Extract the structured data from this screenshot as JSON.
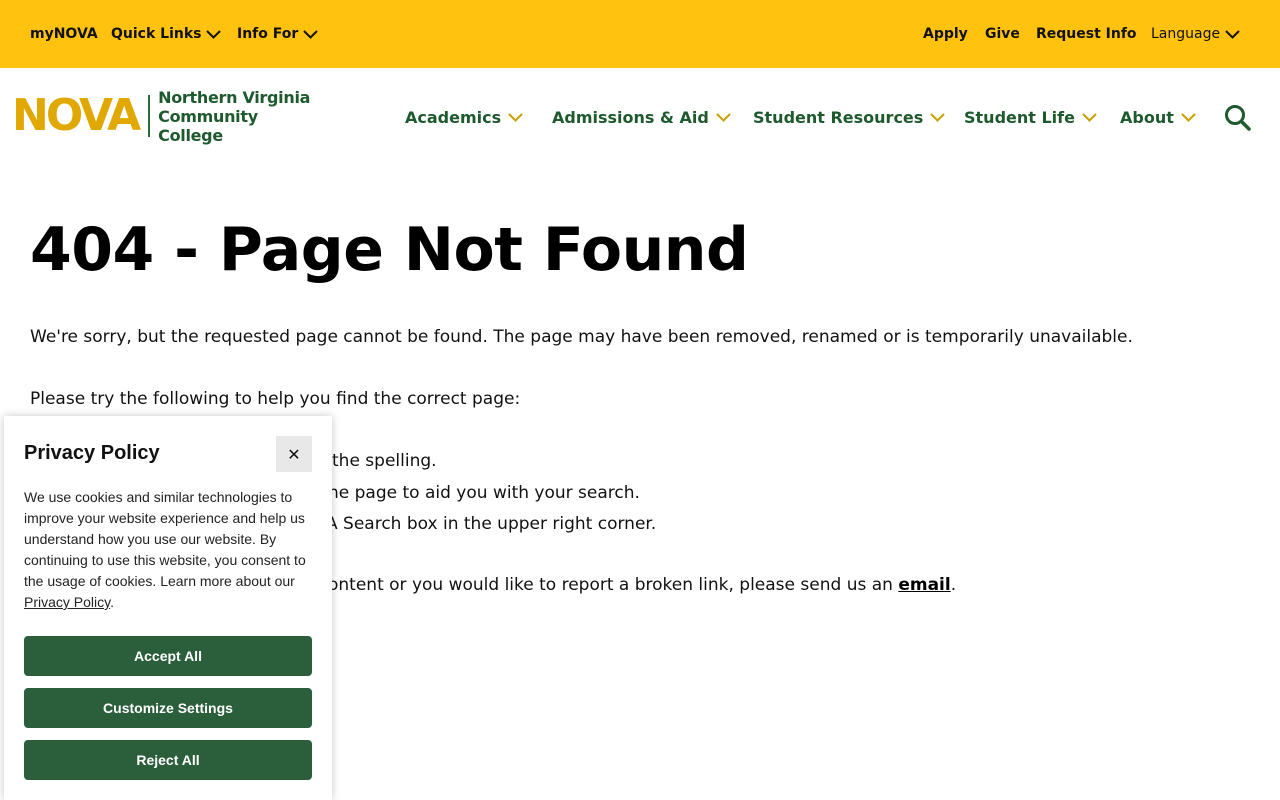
{
  "utility_nav": {
    "mynova": "myNOVA",
    "quick_links": "Quick Links",
    "info_for": "Info For",
    "apply": "Apply",
    "give": "Give",
    "request_info": "Request Info",
    "language": "Language"
  },
  "logo": {
    "mark": "NOVA",
    "line1": "Northern Virginia",
    "line2": "Community College"
  },
  "main_nav": {
    "items": [
      "Academics",
      "Admissions & Aid",
      "Student Resources",
      "Student Life",
      "About"
    ]
  },
  "icons": {
    "search": "search-icon",
    "chevron": "chevron-down-icon",
    "close": "close-icon"
  },
  "content": {
    "title": "404 - Page Not Found",
    "p1": "We're sorry, but the requested page cannot be found. The page may have been removed, renamed or is temporarily unavailable.",
    "p2": "Please try the following to help you find the correct page:",
    "list": [
      "the spelling.",
      "he page to aid you with your search.",
      "A Search box in the upper right corner."
    ],
    "p3_text": "ontent or you would like to report a broken link, please send us an ",
    "p3_link": "email",
    "p3_end": "."
  },
  "cookie": {
    "title": "Privacy Policy",
    "close_label": "✕",
    "body": "We use cookies and similar technologies to improve your website experience and help us understand how you use our website. By continuing to use this website, you consent to the usage of cookies. Learn more about our ",
    "link": "Privacy Policy",
    "body_end": ".",
    "accept": "Accept All",
    "customize": "Customize Settings",
    "reject": "Reject All"
  },
  "colors": {
    "utility_bar": "#ffc20e",
    "brand_green": "#1e5a2e",
    "brand_gold": "#e0a800",
    "chevron_gold": "#c9a000",
    "button_green": "#2b5f3b"
  }
}
